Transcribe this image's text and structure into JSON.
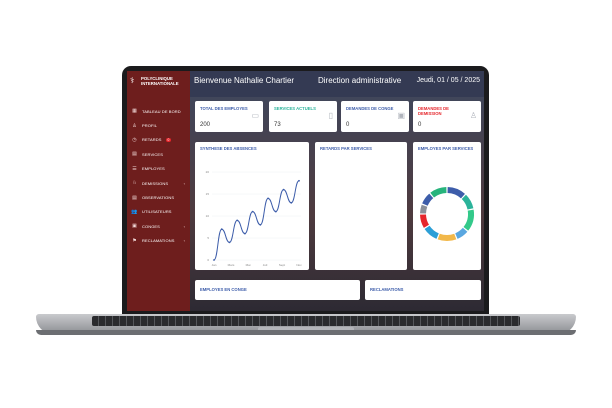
{
  "brand": {
    "name_line1": "POLYCLINIQUE",
    "name_line2": "INTERNATIONALE"
  },
  "sidebar": {
    "items": [
      {
        "label": "TABLEAU DE BORD",
        "icon": "table-icon"
      },
      {
        "label": "PROFIL",
        "icon": "user-icon"
      },
      {
        "label": "RETARDS",
        "icon": "clock-icon",
        "badge": "0"
      },
      {
        "label": "SERVICES",
        "icon": "document-icon"
      },
      {
        "label": "EMPLOYES",
        "icon": "list-icon"
      },
      {
        "label": "DEMISSIONS",
        "icon": "walk-icon",
        "chevron": "‹"
      },
      {
        "label": "OBSERVATIONS",
        "icon": "document-icon"
      },
      {
        "label": "UTILISATEURS",
        "icon": "users-icon"
      },
      {
        "label": "CONGES",
        "icon": "calendar-icon",
        "chevron": "‹"
      },
      {
        "label": "RECLAMATIONS",
        "icon": "flag-icon",
        "chevron": "‹"
      }
    ]
  },
  "header": {
    "greeting": "Bienvenue Nathalie Chartier",
    "department": "Direction administrative",
    "date": "Jeudi, 01 / 05 / 2025"
  },
  "stats": [
    {
      "label": "TOTAL DES EMPLOYES",
      "value": "200",
      "color": "#3d5daa",
      "icon": "id-card-icon"
    },
    {
      "label": "SERVICES ACTUELS",
      "value": "73",
      "color": "#2bb39a",
      "icon": "building-icon"
    },
    {
      "label": "DEMANDES DE CONGE",
      "value": "0",
      "color": "#3d5daa",
      "icon": "calendar-icon"
    },
    {
      "label": "DEMANDES DE DEMISSION",
      "value": "0",
      "color": "#e5262c",
      "icon": "person-icon"
    }
  ],
  "panels": {
    "absences": "SYNTHESE DES ABSENCES",
    "retards": "RETARDS PAR SERVICES",
    "employes": "EMPLOYES PAR SERVICES",
    "conge": "EMPLOYES EN CONGE",
    "reclamations": "RECLAMATIONS"
  },
  "chart_data": [
    {
      "type": "line",
      "title": "SYNTHESE DES ABSENCES",
      "categories": [
        "Jan",
        "Mar",
        "Mai",
        "Jul",
        "Sep",
        "Nov"
      ],
      "x_ticks": [
        "Jan",
        "Mars",
        "Mai",
        "Juil",
        "Sept",
        "Nov"
      ],
      "y_ticks": [
        0,
        5,
        10,
        15,
        20
      ],
      "ylim": [
        0,
        20
      ],
      "series": [
        {
          "values": [
            0,
            7,
            4,
            9,
            6,
            11,
            8,
            14,
            11,
            16,
            13,
            18
          ]
        }
      ],
      "color": "#3d5daa",
      "grid": true
    },
    {
      "type": "pie",
      "subtype": "donut",
      "title": "EMPLOYES PAR SERVICES",
      "values": [
        12,
        10,
        14,
        8,
        12,
        10,
        9,
        6,
        8,
        11
      ],
      "colors": [
        "#3d5daa",
        "#2bb39a",
        "#33c98a",
        "#5aa7e0",
        "#f2b84a",
        "#2c9fd6",
        "#e5262c",
        "#8a8f99",
        "#3d5daa",
        "#27b47c"
      ]
    }
  ],
  "colors": {
    "sidebar": "#6e1e1d",
    "header": "#343a53",
    "accent": "#3d5daa",
    "danger": "#e5262c",
    "success": "#2bb39a"
  }
}
